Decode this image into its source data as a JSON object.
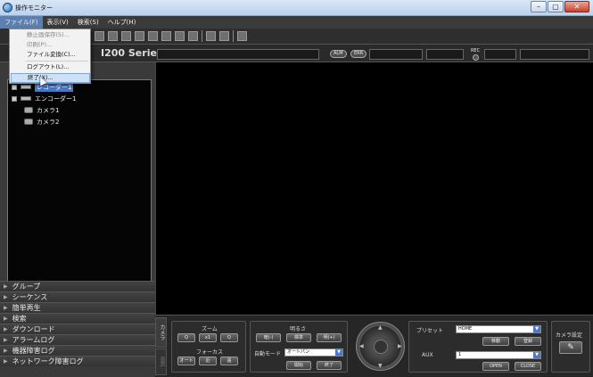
{
  "window": {
    "title": "操作モニター",
    "buttons": [
      "–",
      "▢",
      "✕"
    ]
  },
  "menubar": [
    {
      "label": "ファイル(F)",
      "active": true
    },
    {
      "label": "表示(V)"
    },
    {
      "label": "検索(S)"
    },
    {
      "label": "ヘルプ(H)"
    }
  ],
  "file_menu": {
    "items": [
      {
        "label": "静止画保存(S)...",
        "disabled": true
      },
      {
        "label": "印刷(P)...",
        "disabled": true
      },
      {
        "label": "ファイル変換(C)..."
      },
      {
        "label": "ログアウト(L)..."
      },
      {
        "label": "終了(X)...",
        "hover": true
      }
    ]
  },
  "header": {
    "series_text": "I200 Series",
    "alarm_pill": "ALM",
    "err_pill": "ERR",
    "rec_label": "REC"
  },
  "tree": {
    "rows": [
      {
        "label": "レコーダー1",
        "type": "recorder",
        "highlighted": true
      },
      {
        "label": "エンコーダー1",
        "type": "encoder"
      },
      {
        "label": "カメラ1",
        "type": "camera"
      },
      {
        "label": "カメラ2",
        "type": "camera"
      }
    ]
  },
  "nav": [
    "グループ",
    "シーケンス",
    "簡単再生",
    "検索",
    "ダウンロード",
    "アラームログ",
    "機器障害ログ",
    "ネットワーク障害ログ"
  ],
  "controls": {
    "tab_camera": "カメラ",
    "tab_audio": "音声",
    "zoom_label": "ズーム",
    "zoom_buttons": [
      "Q",
      "x1",
      "Q"
    ],
    "focus_label": "フォーカス",
    "focus_buttons": [
      "オート",
      "近",
      "遠"
    ],
    "brightness_label": "明るさ",
    "brightness_buttons": [
      "暗(-)",
      "標準",
      "明(+)"
    ],
    "auto_mode_label": "自動モード",
    "auto_mode_value": "オートパン",
    "auto_mode_buttons": [
      "開始",
      "終了"
    ],
    "preset_label": "プリセット",
    "preset_value": "HOME",
    "preset_buttons": [
      "移動",
      "登録"
    ],
    "aux_label": "AUX",
    "aux_value": "1",
    "aux_buttons": [
      "OPEN",
      "CLOSE"
    ],
    "camera_settings_label": "カメラ設定"
  }
}
